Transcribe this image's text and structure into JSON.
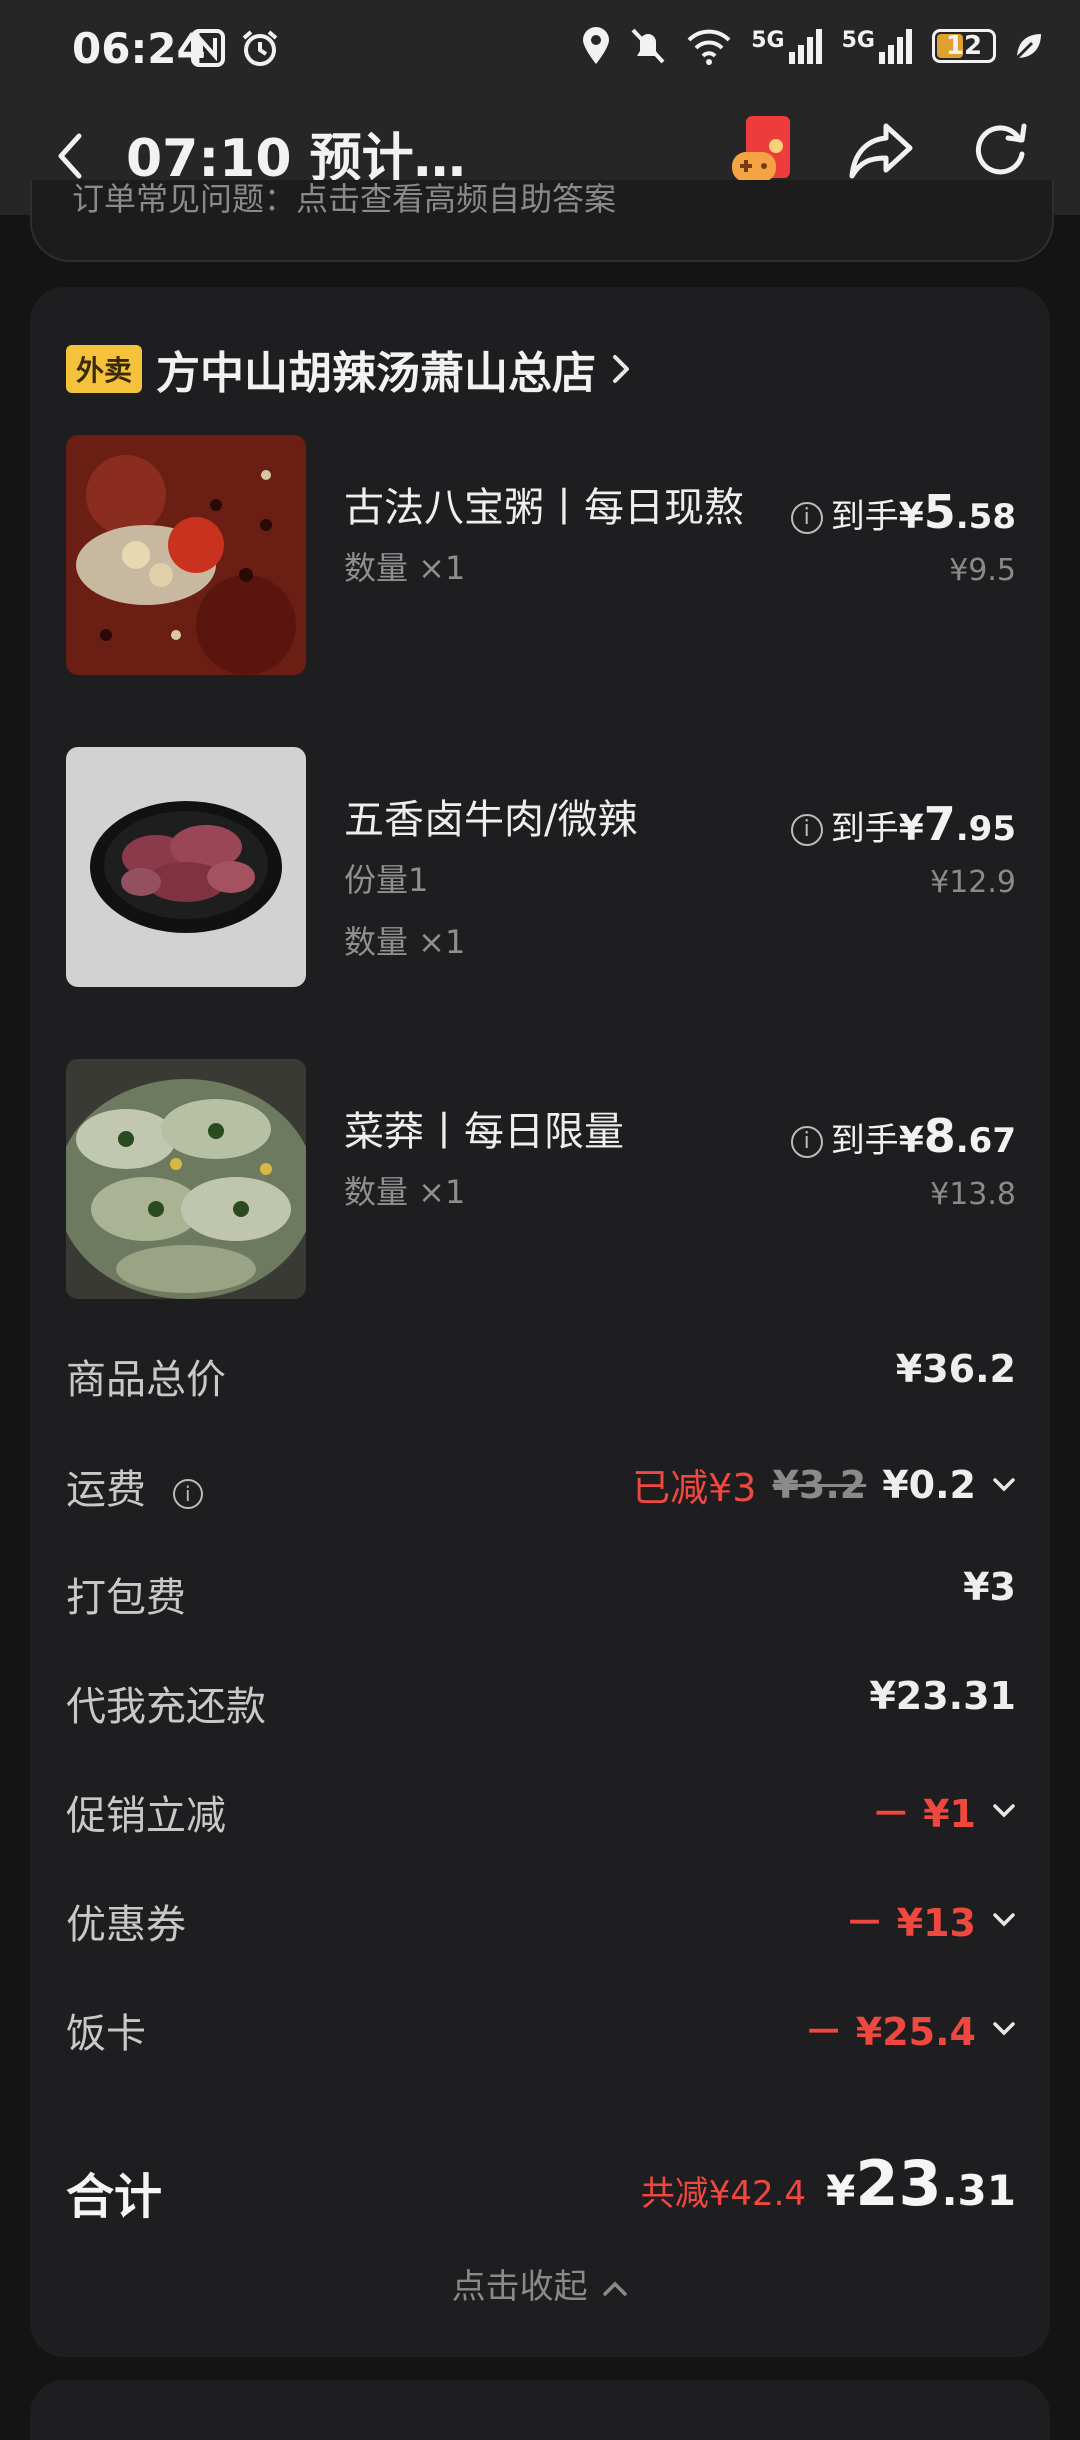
{
  "status_bar": {
    "time": "06:24",
    "signal1_label": "5G",
    "signal2_label": "5G",
    "battery": "12",
    "battery_color": "#e0a030"
  },
  "navbar": {
    "title": "07:10 预计…"
  },
  "notice": {
    "text": "订单常见问题：点击查看高频自助答案"
  },
  "store": {
    "tag": "外卖",
    "tag_color": "#f5c23c",
    "name": "方中山胡辣汤萧山总店"
  },
  "items": [
    {
      "name": "古法八宝粥丨每日现熬",
      "subs": [
        "数量 ×1"
      ],
      "price_prefix": "到手",
      "price_symbol": "¥",
      "price_int": "5",
      "price_dec": ".58",
      "original": "¥9.5"
    },
    {
      "name": "五香卤牛肉/微辣",
      "subs": [
        "份量1",
        "数量 ×1"
      ],
      "price_prefix": "到手",
      "price_symbol": "¥",
      "price_int": "7",
      "price_dec": ".95",
      "original": "¥12.9"
    },
    {
      "name": "菜莽丨每日限量",
      "subs": [
        "数量 ×1"
      ],
      "price_prefix": "到手",
      "price_symbol": "¥",
      "price_int": "8",
      "price_dec": ".67",
      "original": "¥13.8"
    }
  ],
  "fees": {
    "subtotal": {
      "label": "商品总价",
      "value": "¥36.2"
    },
    "delivery": {
      "label": "运费",
      "discount": "已减¥3",
      "original": "¥3.2",
      "value": "¥0.2"
    },
    "packaging": {
      "label": "打包费",
      "value": "¥3"
    },
    "recharge": {
      "label": "代我充还款",
      "value": "¥23.31"
    },
    "promo": {
      "label": "促销立减",
      "value": "－ ¥1"
    },
    "coupon": {
      "label": "优惠券",
      "value": "－ ¥13"
    },
    "mealcard": {
      "label": "饭卡",
      "value": "－ ¥25.4"
    }
  },
  "total": {
    "label": "合计",
    "saved": "共减¥42.4",
    "symbol": "¥",
    "int": "23",
    "dec": ".31"
  },
  "collapse": {
    "label": "点击收起"
  },
  "colors": {
    "discount_red": "#f0483e",
    "background": "#141414",
    "card": "#1e1e20"
  }
}
